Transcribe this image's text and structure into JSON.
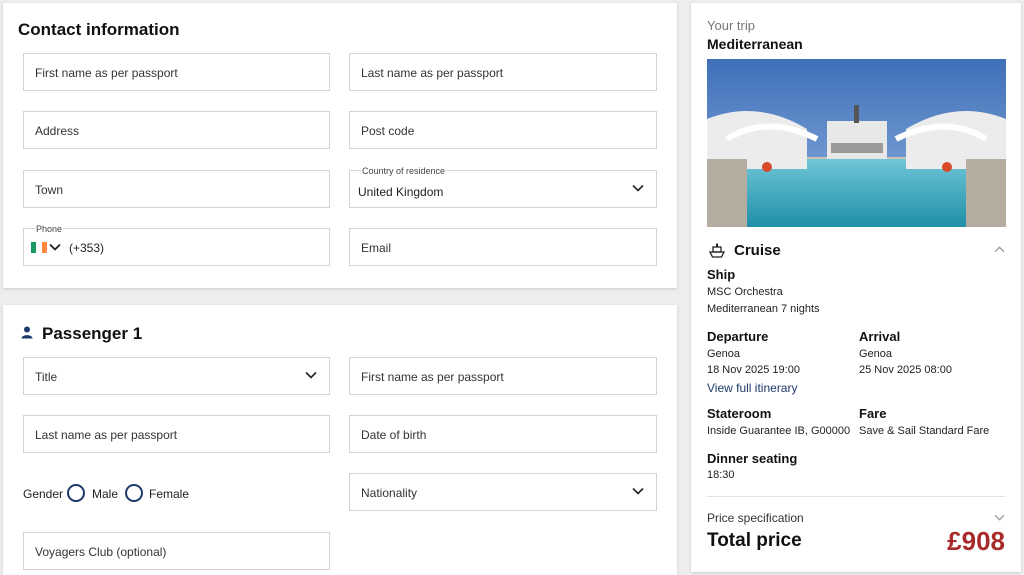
{
  "contact": {
    "title": "Contact information",
    "first_name_placeholder": "First name as per passport",
    "last_name_placeholder": "Last name as per passport",
    "address_placeholder": "Address",
    "postcode_placeholder": "Post code",
    "town_placeholder": "Town",
    "country_label": "Country of residence",
    "country_value": "United Kingdom",
    "phone_label": "Phone",
    "phone_code": "(+353)",
    "email_placeholder": "Email"
  },
  "passenger": {
    "title": "Passenger 1",
    "title_select": "Title",
    "first_name_placeholder": "First name as per passport",
    "last_name_placeholder": "Last name as per passport",
    "dob_placeholder": "Date of birth",
    "gender_label": "Gender",
    "gender_options": [
      "Male",
      "Female"
    ],
    "nationality_placeholder": "Nationality",
    "voyagers_placeholder": "Voyagers Club (optional)"
  },
  "trip": {
    "heading": "Your trip",
    "destination": "Mediterranean",
    "section": "Cruise",
    "ship_label": "Ship",
    "ship_name": "MSC Orchestra",
    "ship_itinerary": "Mediterranean 7 nights",
    "departure_label": "Departure",
    "departure_port": "Genoa",
    "departure_time": "18 Nov 2025 19:00",
    "arrival_label": "Arrival",
    "arrival_port": "Genoa",
    "arrival_time": "25 Nov 2025 08:00",
    "itinerary_link": "View full itinerary",
    "stateroom_label": "Stateroom",
    "stateroom_value": "Inside Guarantee IB, G00000",
    "fare_label": "Fare",
    "fare_value": "Save & Sail Standard Fare",
    "dinner_label": "Dinner seating",
    "dinner_value": "18:30",
    "price_spec": "Price specification",
    "total_label": "Total price",
    "total_value": "£908"
  },
  "colors": {
    "navy": "#1e3a6b",
    "price_red": "#a82b2b",
    "link_blue": "#1e3a6b"
  },
  "icons": {
    "person": "person-icon",
    "ship": "ship-icon",
    "chevron": "chevron-down-icon",
    "chevron_up": "chevron-up-icon",
    "flag": "ireland-flag-icon"
  }
}
